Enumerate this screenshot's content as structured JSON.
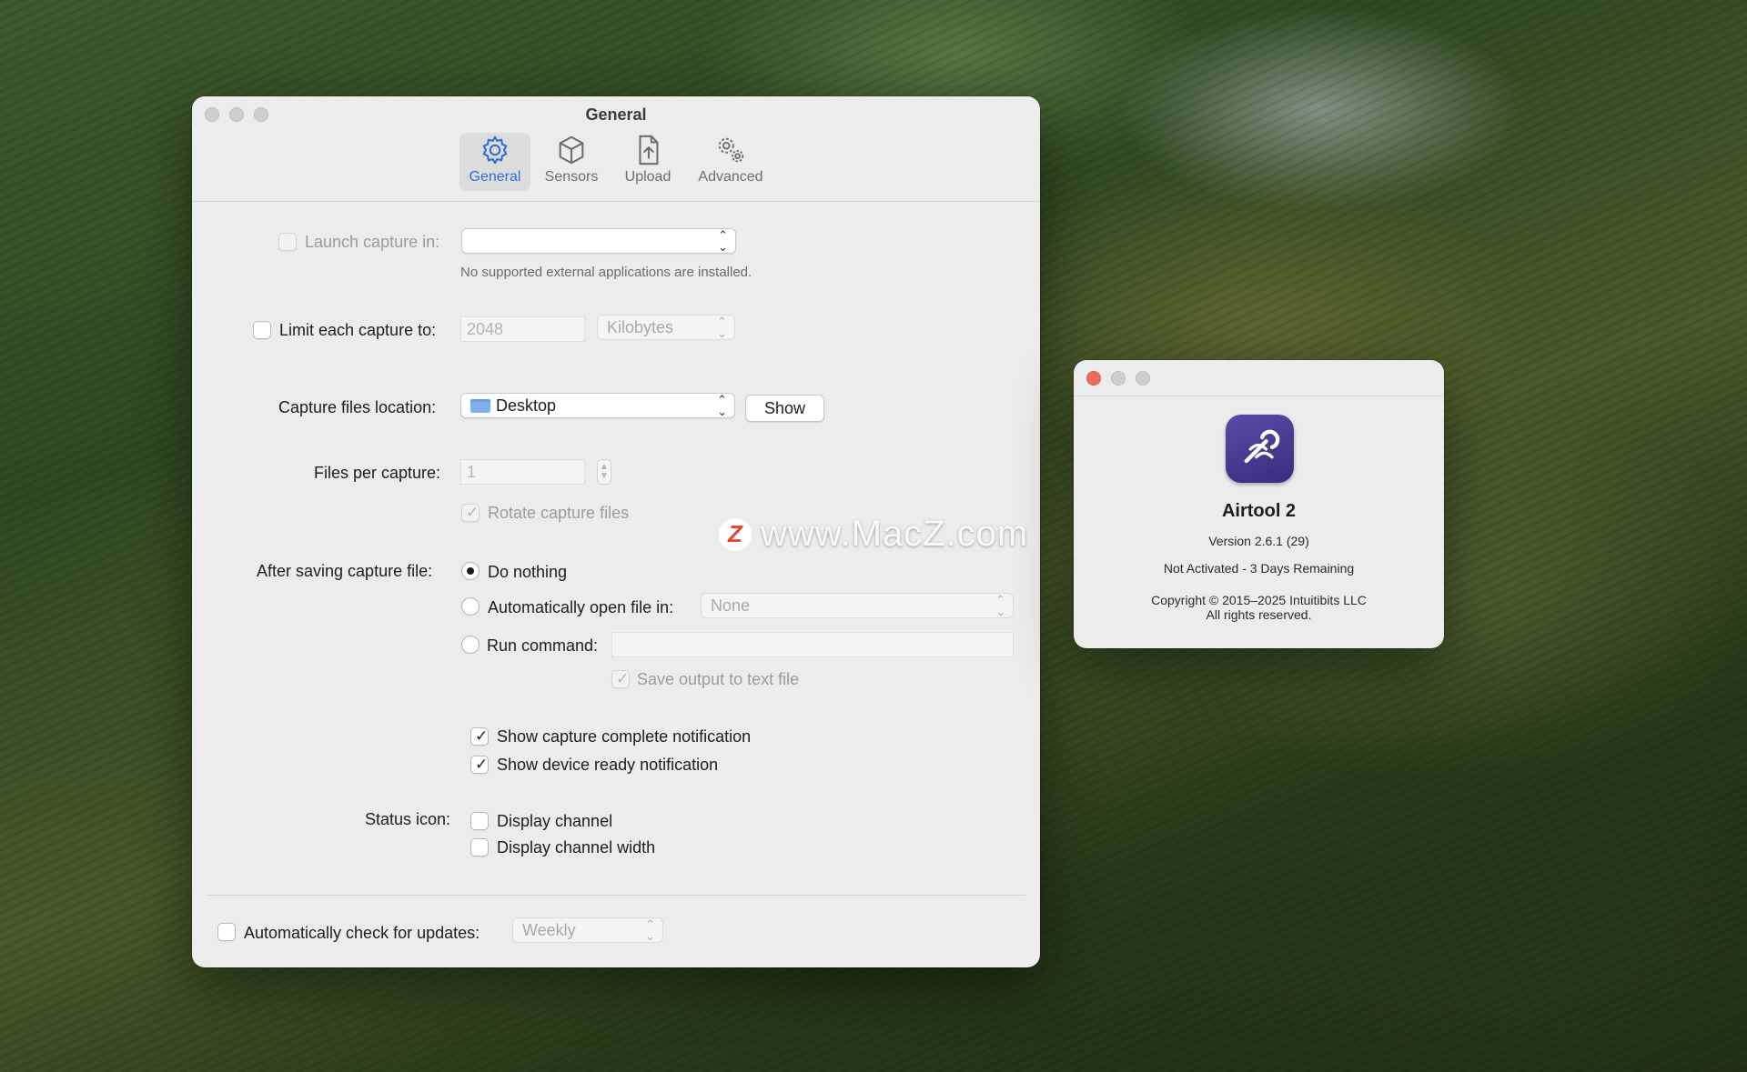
{
  "main_window": {
    "title": "General",
    "tabs": [
      {
        "label": "General",
        "icon": "gear-icon"
      },
      {
        "label": "Sensors",
        "icon": "cube-icon"
      },
      {
        "label": "Upload",
        "icon": "upload-file-icon"
      },
      {
        "label": "Advanced",
        "icon": "gears-icon"
      }
    ],
    "active_tab": "General",
    "launch_capture": {
      "label": "Launch capture in:",
      "checked": false,
      "enabled": false,
      "value": "",
      "note": "No supported external applications are installed."
    },
    "limit_capture": {
      "label": "Limit each capture to:",
      "checked": false,
      "placeholder": "2048",
      "unit": "Kilobytes"
    },
    "location": {
      "label": "Capture files location:",
      "folder_icon": "folder-icon",
      "value": "Desktop",
      "show_button": "Show"
    },
    "files_per_capture": {
      "label": "Files per capture:",
      "value": "1"
    },
    "rotate": {
      "label": "Rotate capture files",
      "checked": true,
      "enabled": false
    },
    "after_saving": {
      "label": "After saving capture file:",
      "options": [
        {
          "label": "Do nothing",
          "selected": true
        },
        {
          "label": "Automatically open file in:",
          "selected": false,
          "popup_value": "None"
        },
        {
          "label": "Run command:",
          "selected": false,
          "field_value": ""
        }
      ],
      "save_output": {
        "label": "Save output to text file",
        "checked": true,
        "enabled": false
      }
    },
    "notifications": [
      {
        "label": "Show capture complete notification",
        "checked": true
      },
      {
        "label": "Show device ready notification",
        "checked": true
      }
    ],
    "status_icon": {
      "label": "Status icon:",
      "options": [
        {
          "label": "Display channel",
          "checked": false
        },
        {
          "label": "Display channel width",
          "checked": false
        }
      ]
    },
    "updates": {
      "label": "Automatically check for updates:",
      "checked": false,
      "value": "Weekly"
    }
  },
  "about_window": {
    "app_name": "Airtool 2",
    "version": "Version 2.6.1 (29)",
    "status": "Not Activated - 3 Days Remaining",
    "copyright": "Copyright © 2015–2025 Intuitibits LLC",
    "rights": "All rights reserved.",
    "icon": "airtool-app-icon"
  },
  "watermark": {
    "text": "www.MacZ.com",
    "logo": "Z"
  },
  "colors": {
    "accent": "#2d6fd9",
    "close_red": "#ec6a5e",
    "window_bg": "#ececec"
  }
}
